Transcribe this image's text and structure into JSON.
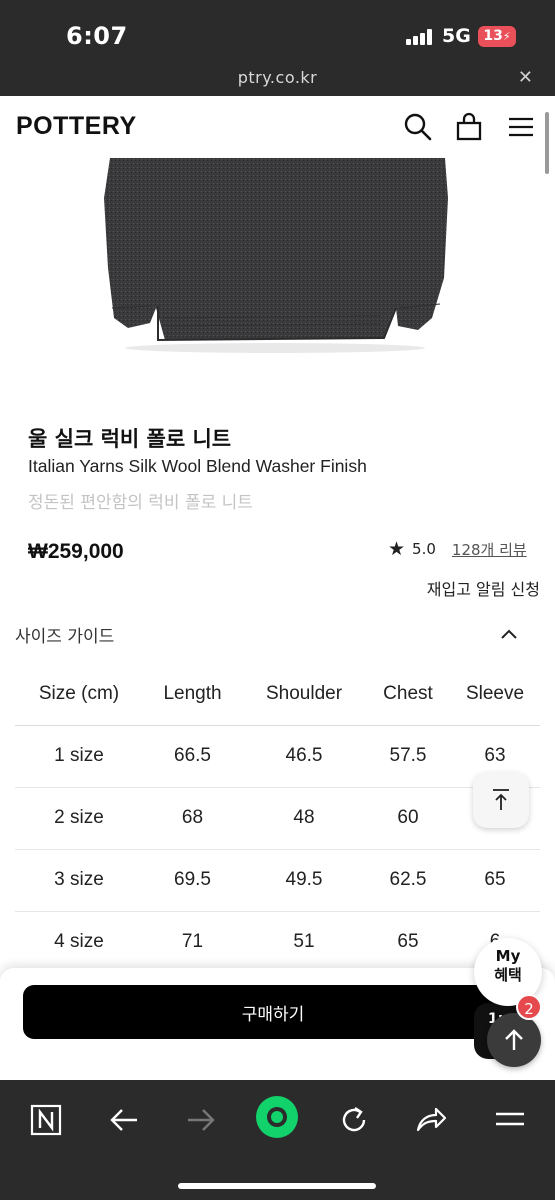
{
  "status": {
    "time": "6:07",
    "network": "5G",
    "battery": "13"
  },
  "browser": {
    "url": "ptry.co.kr",
    "close_symbol": "✕"
  },
  "header": {
    "logo": "POTTERY",
    "icons": [
      "search-icon",
      "shopping-bag-icon",
      "menu-icon"
    ]
  },
  "product": {
    "title_ko": "울 실크 럭비 폴로 니트",
    "title_en": "Italian Yarns Silk Wool Blend Washer Finish",
    "subtitle": "정돈된 편안함의 럭비 폴로 니트",
    "price": "₩259,000",
    "rating_star": "★",
    "rating": "5.0",
    "reviews": "128개 리뷰",
    "restock": "재입고 알림 신청"
  },
  "size_guide": {
    "title": "사이즈 가이드",
    "columns": [
      "Size (cm)",
      "Length",
      "Shoulder",
      "Chest",
      "Sleeve"
    ],
    "rows": [
      [
        "1 size",
        "66.5",
        "46.5",
        "57.5",
        "63"
      ],
      [
        "2 size",
        "68",
        "48",
        "60",
        ""
      ],
      [
        "3 size",
        "69.5",
        "49.5",
        "62.5",
        "65"
      ],
      [
        "4 size",
        "71",
        "51",
        "65",
        "6"
      ]
    ]
  },
  "purchase": {
    "buy_label": "구매하기",
    "partial_label": "1:"
  },
  "floating": {
    "benefit_line1": "My",
    "benefit_line2": "혜택",
    "notification_count": "2"
  },
  "nav": {
    "items": [
      "naver-n-icon",
      "back-arrow-icon",
      "forward-arrow-icon",
      "green-home-icon",
      "refresh-icon",
      "share-icon",
      "menu-icon"
    ]
  },
  "colors": {
    "dark_bar": "#2b2b2b",
    "buy_button": "#000000",
    "badge_red": "#e5484d",
    "nav_green": "#12d26b"
  }
}
